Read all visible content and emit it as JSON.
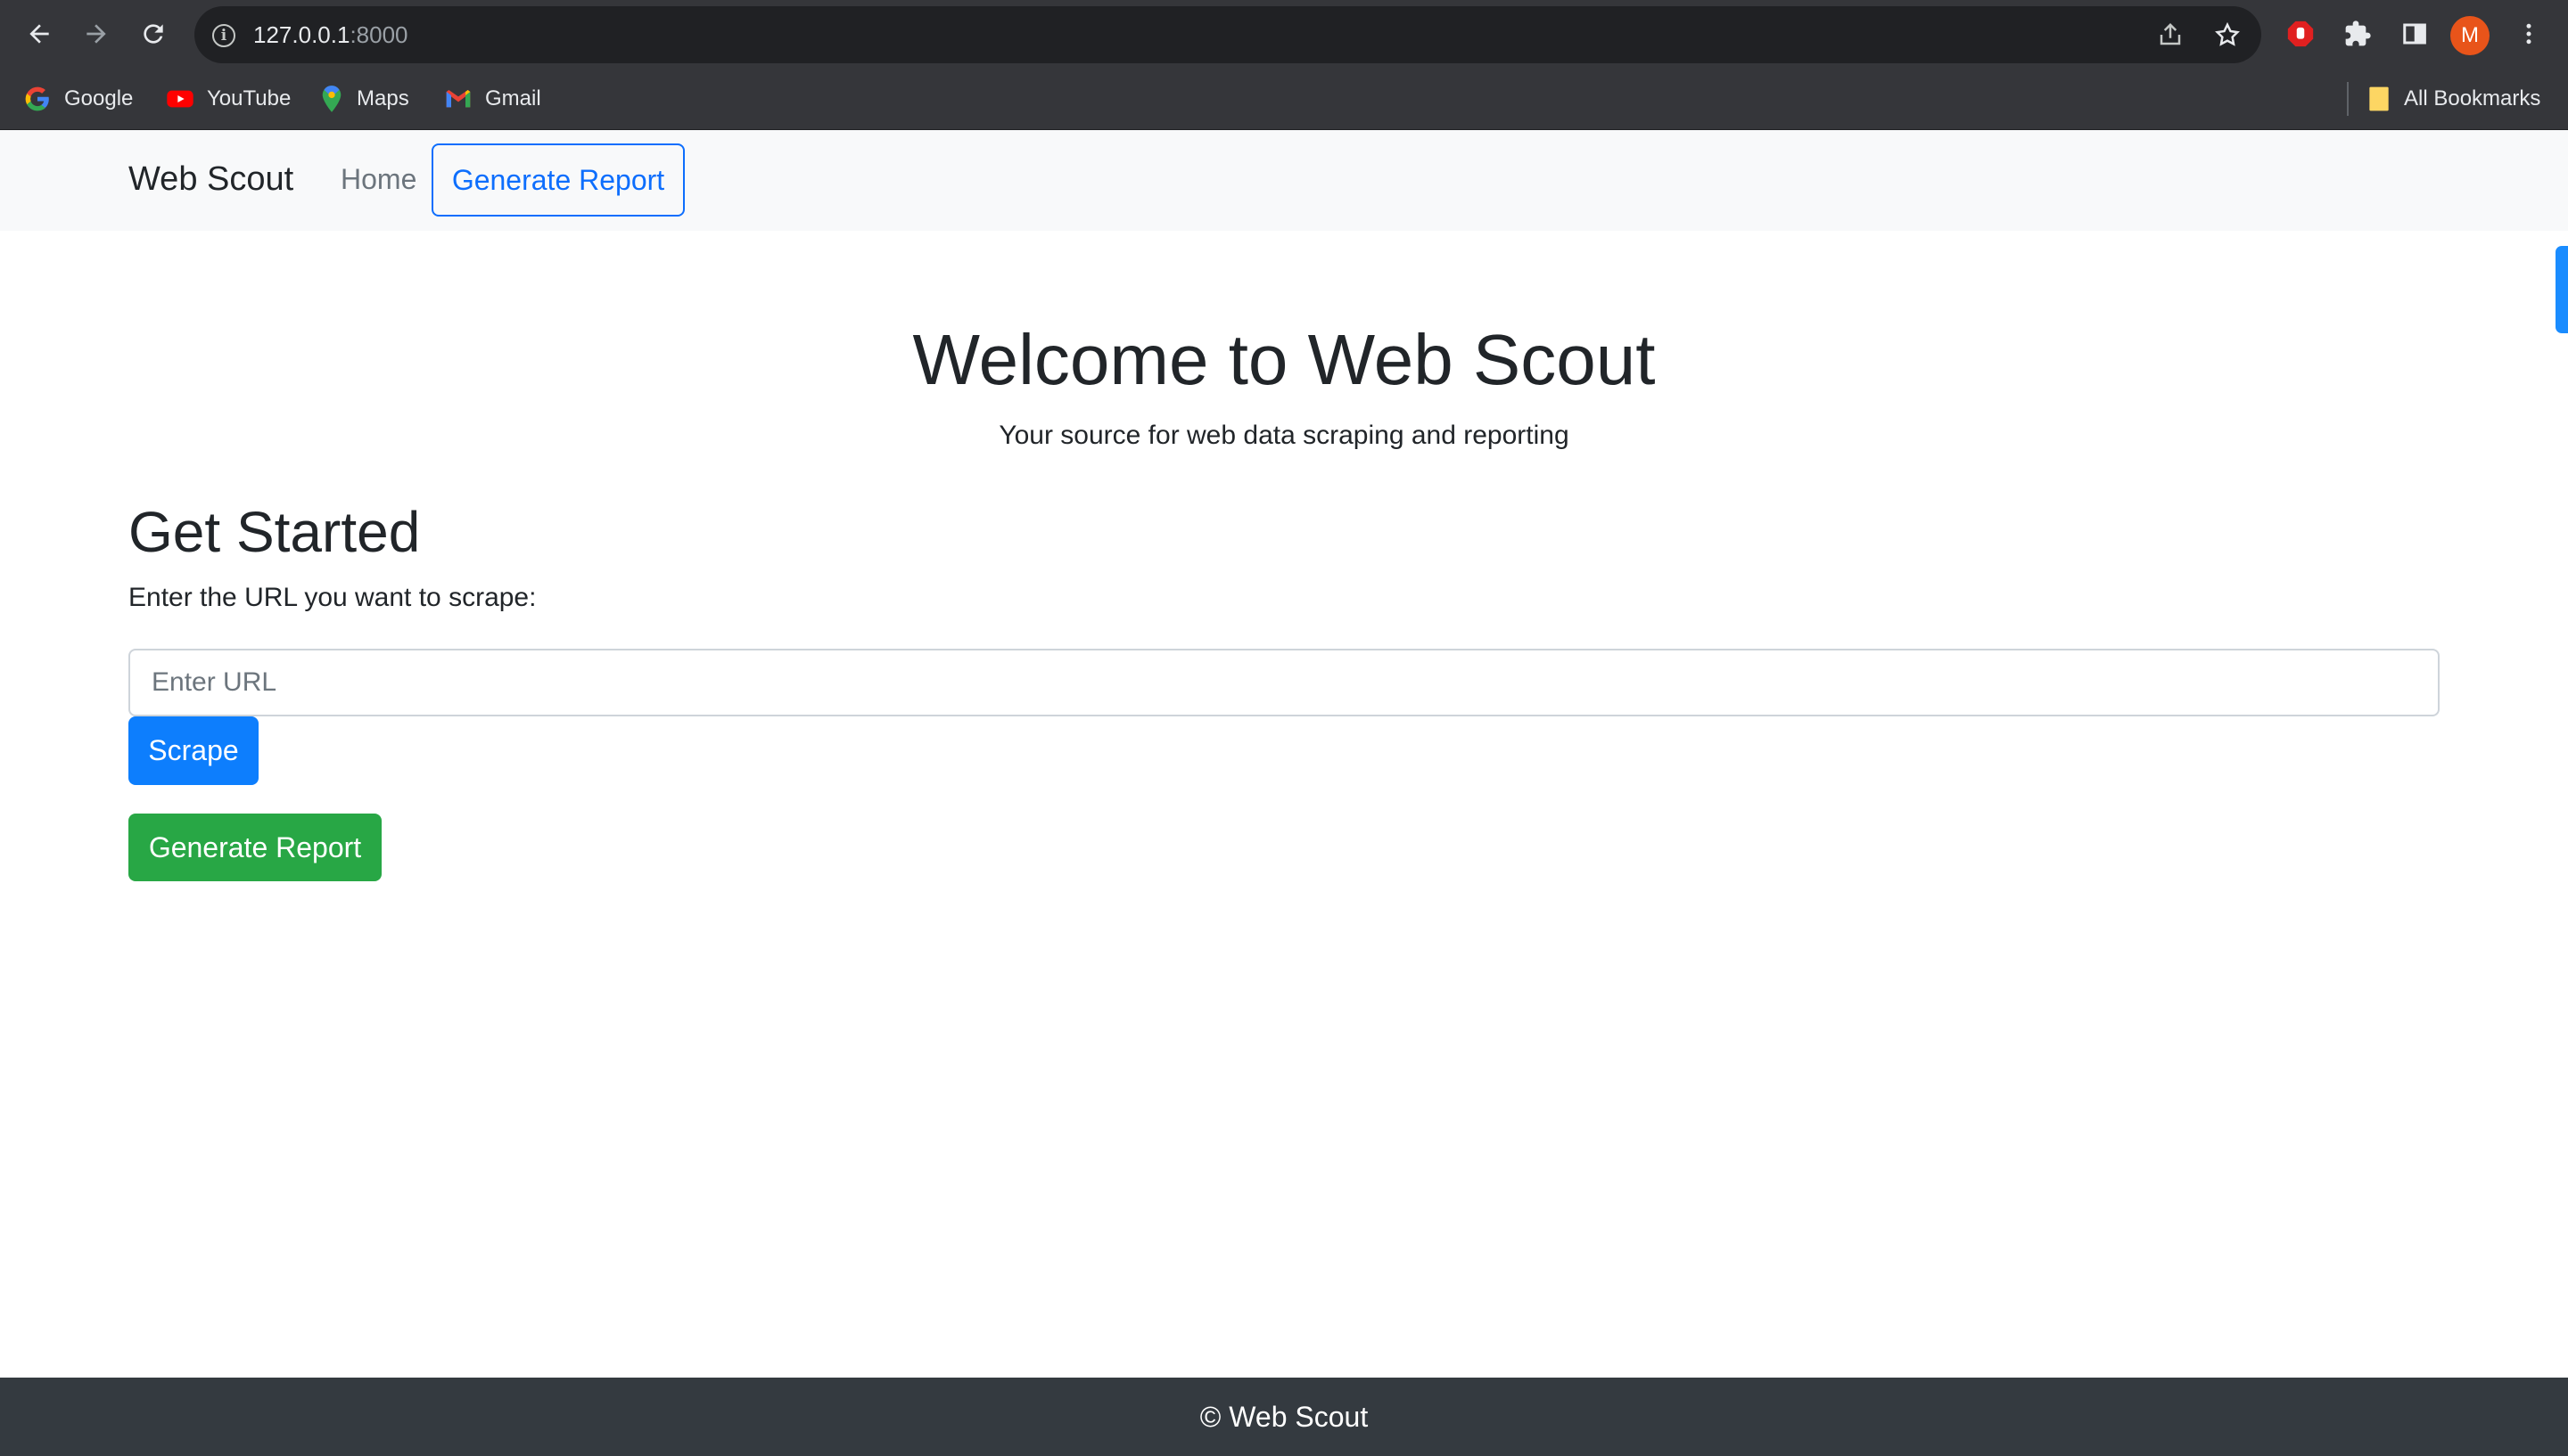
{
  "browser": {
    "url_host": "127.0.0.1",
    "url_port": ":8000",
    "avatar_letter": "M",
    "bookmarks": [
      "Google",
      "YouTube",
      "Maps",
      "Gmail"
    ],
    "all_bookmarks": "All Bookmarks"
  },
  "nav": {
    "brand": "Web Scout",
    "home": "Home",
    "generate_report": "Generate Report"
  },
  "hero": {
    "title": "Welcome to Web Scout",
    "subtitle": "Your source for web data scraping and reporting"
  },
  "main": {
    "heading": "Get Started",
    "label": "Enter the URL you want to scrape:",
    "url_placeholder": "Enter URL",
    "url_value": "",
    "scrape_button": "Scrape",
    "report_button": "Generate Report"
  },
  "footer": {
    "text": "© Web Scout"
  },
  "colors": {
    "primary": "#0d7efd",
    "success": "#28a745",
    "footer_bg": "#343a40",
    "navbar_bg": "#f8f9fa"
  }
}
